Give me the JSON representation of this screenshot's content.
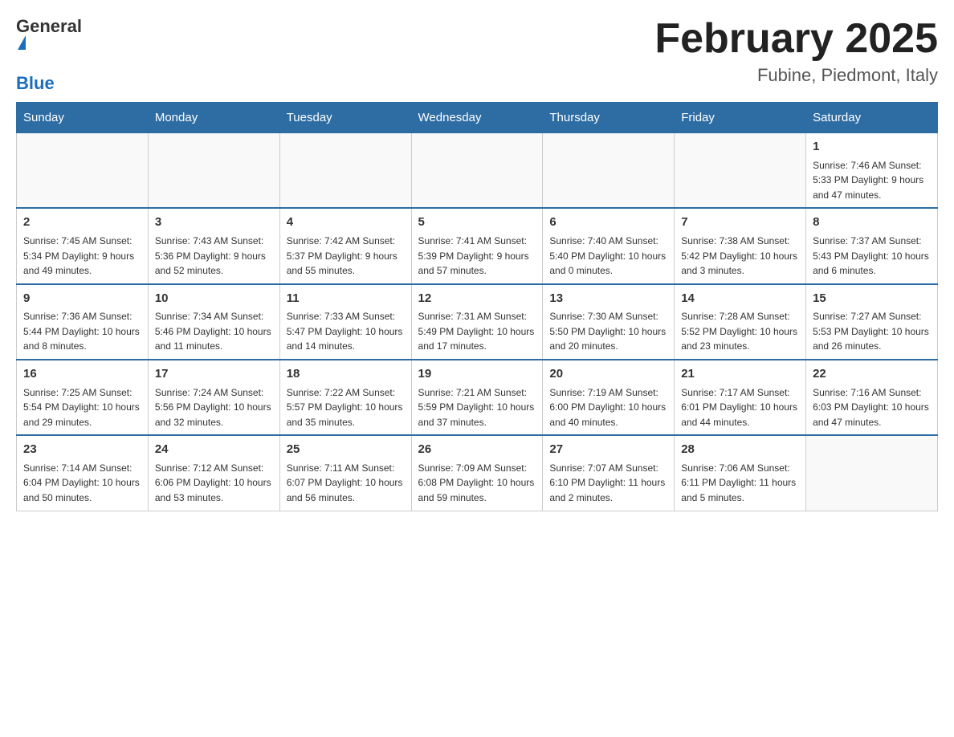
{
  "logo": {
    "general": "General",
    "blue": "Blue"
  },
  "title": "February 2025",
  "subtitle": "Fubine, Piedmont, Italy",
  "weekdays": [
    "Sunday",
    "Monday",
    "Tuesday",
    "Wednesday",
    "Thursday",
    "Friday",
    "Saturday"
  ],
  "weeks": [
    [
      {
        "day": "",
        "info": ""
      },
      {
        "day": "",
        "info": ""
      },
      {
        "day": "",
        "info": ""
      },
      {
        "day": "",
        "info": ""
      },
      {
        "day": "",
        "info": ""
      },
      {
        "day": "",
        "info": ""
      },
      {
        "day": "1",
        "info": "Sunrise: 7:46 AM\nSunset: 5:33 PM\nDaylight: 9 hours and 47 minutes."
      }
    ],
    [
      {
        "day": "2",
        "info": "Sunrise: 7:45 AM\nSunset: 5:34 PM\nDaylight: 9 hours and 49 minutes."
      },
      {
        "day": "3",
        "info": "Sunrise: 7:43 AM\nSunset: 5:36 PM\nDaylight: 9 hours and 52 minutes."
      },
      {
        "day": "4",
        "info": "Sunrise: 7:42 AM\nSunset: 5:37 PM\nDaylight: 9 hours and 55 minutes."
      },
      {
        "day": "5",
        "info": "Sunrise: 7:41 AM\nSunset: 5:39 PM\nDaylight: 9 hours and 57 minutes."
      },
      {
        "day": "6",
        "info": "Sunrise: 7:40 AM\nSunset: 5:40 PM\nDaylight: 10 hours and 0 minutes."
      },
      {
        "day": "7",
        "info": "Sunrise: 7:38 AM\nSunset: 5:42 PM\nDaylight: 10 hours and 3 minutes."
      },
      {
        "day": "8",
        "info": "Sunrise: 7:37 AM\nSunset: 5:43 PM\nDaylight: 10 hours and 6 minutes."
      }
    ],
    [
      {
        "day": "9",
        "info": "Sunrise: 7:36 AM\nSunset: 5:44 PM\nDaylight: 10 hours and 8 minutes."
      },
      {
        "day": "10",
        "info": "Sunrise: 7:34 AM\nSunset: 5:46 PM\nDaylight: 10 hours and 11 minutes."
      },
      {
        "day": "11",
        "info": "Sunrise: 7:33 AM\nSunset: 5:47 PM\nDaylight: 10 hours and 14 minutes."
      },
      {
        "day": "12",
        "info": "Sunrise: 7:31 AM\nSunset: 5:49 PM\nDaylight: 10 hours and 17 minutes."
      },
      {
        "day": "13",
        "info": "Sunrise: 7:30 AM\nSunset: 5:50 PM\nDaylight: 10 hours and 20 minutes."
      },
      {
        "day": "14",
        "info": "Sunrise: 7:28 AM\nSunset: 5:52 PM\nDaylight: 10 hours and 23 minutes."
      },
      {
        "day": "15",
        "info": "Sunrise: 7:27 AM\nSunset: 5:53 PM\nDaylight: 10 hours and 26 minutes."
      }
    ],
    [
      {
        "day": "16",
        "info": "Sunrise: 7:25 AM\nSunset: 5:54 PM\nDaylight: 10 hours and 29 minutes."
      },
      {
        "day": "17",
        "info": "Sunrise: 7:24 AM\nSunset: 5:56 PM\nDaylight: 10 hours and 32 minutes."
      },
      {
        "day": "18",
        "info": "Sunrise: 7:22 AM\nSunset: 5:57 PM\nDaylight: 10 hours and 35 minutes."
      },
      {
        "day": "19",
        "info": "Sunrise: 7:21 AM\nSunset: 5:59 PM\nDaylight: 10 hours and 37 minutes."
      },
      {
        "day": "20",
        "info": "Sunrise: 7:19 AM\nSunset: 6:00 PM\nDaylight: 10 hours and 40 minutes."
      },
      {
        "day": "21",
        "info": "Sunrise: 7:17 AM\nSunset: 6:01 PM\nDaylight: 10 hours and 44 minutes."
      },
      {
        "day": "22",
        "info": "Sunrise: 7:16 AM\nSunset: 6:03 PM\nDaylight: 10 hours and 47 minutes."
      }
    ],
    [
      {
        "day": "23",
        "info": "Sunrise: 7:14 AM\nSunset: 6:04 PM\nDaylight: 10 hours and 50 minutes."
      },
      {
        "day": "24",
        "info": "Sunrise: 7:12 AM\nSunset: 6:06 PM\nDaylight: 10 hours and 53 minutes."
      },
      {
        "day": "25",
        "info": "Sunrise: 7:11 AM\nSunset: 6:07 PM\nDaylight: 10 hours and 56 minutes."
      },
      {
        "day": "26",
        "info": "Sunrise: 7:09 AM\nSunset: 6:08 PM\nDaylight: 10 hours and 59 minutes."
      },
      {
        "day": "27",
        "info": "Sunrise: 7:07 AM\nSunset: 6:10 PM\nDaylight: 11 hours and 2 minutes."
      },
      {
        "day": "28",
        "info": "Sunrise: 7:06 AM\nSunset: 6:11 PM\nDaylight: 11 hours and 5 minutes."
      },
      {
        "day": "",
        "info": ""
      }
    ]
  ]
}
